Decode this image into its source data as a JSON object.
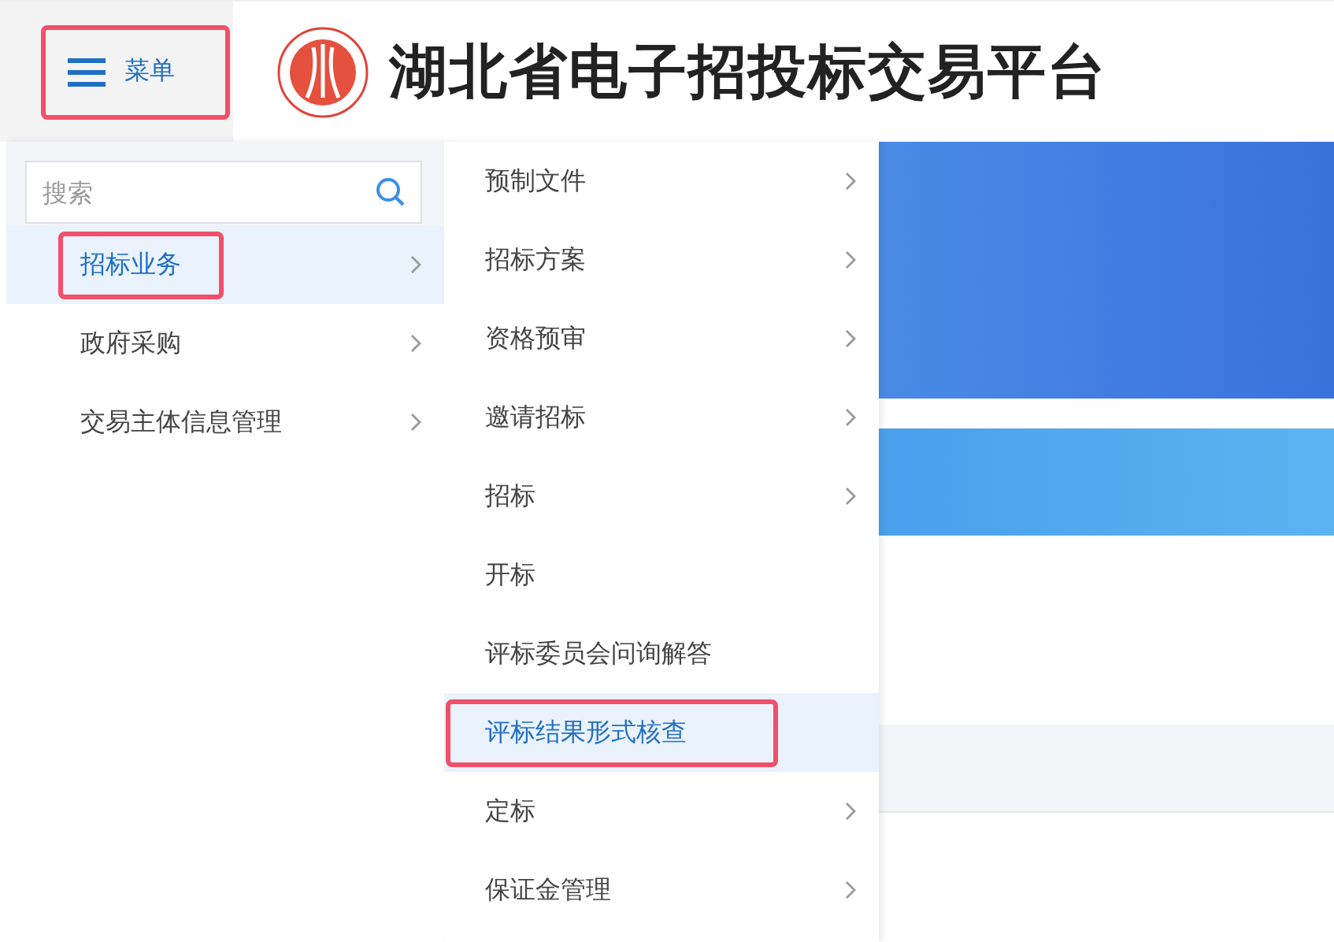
{
  "header": {
    "menu_button": {
      "label": "菜单",
      "annotated": true
    },
    "title": "湖北省电子招投标交易平台"
  },
  "search": {
    "placeholder": "搜索"
  },
  "categories": [
    {
      "label": "招标业务",
      "selected": true,
      "annotated": true,
      "has_submenu": true
    },
    {
      "label": "政府采购",
      "selected": false,
      "annotated": false,
      "has_submenu": true
    },
    {
      "label": "交易主体信息管理",
      "selected": false,
      "annotated": false,
      "has_submenu": true
    }
  ],
  "submenu": [
    {
      "label": "预制文件",
      "selected": false,
      "annotated": false,
      "has_submenu": true
    },
    {
      "label": "招标方案",
      "selected": false,
      "annotated": false,
      "has_submenu": true
    },
    {
      "label": "资格预审",
      "selected": false,
      "annotated": false,
      "has_submenu": true
    },
    {
      "label": "邀请招标",
      "selected": false,
      "annotated": false,
      "has_submenu": true
    },
    {
      "label": "招标",
      "selected": false,
      "annotated": false,
      "has_submenu": true
    },
    {
      "label": "开标",
      "selected": false,
      "annotated": false,
      "has_submenu": false
    },
    {
      "label": "评标委员会问询解答",
      "selected": false,
      "annotated": false,
      "has_submenu": false
    },
    {
      "label": "评标结果形式核查",
      "selected": true,
      "annotated": true,
      "has_submenu": false
    },
    {
      "label": "定标",
      "selected": false,
      "annotated": false,
      "has_submenu": true
    },
    {
      "label": "保证金管理",
      "selected": false,
      "annotated": false,
      "has_submenu": true
    }
  ]
}
